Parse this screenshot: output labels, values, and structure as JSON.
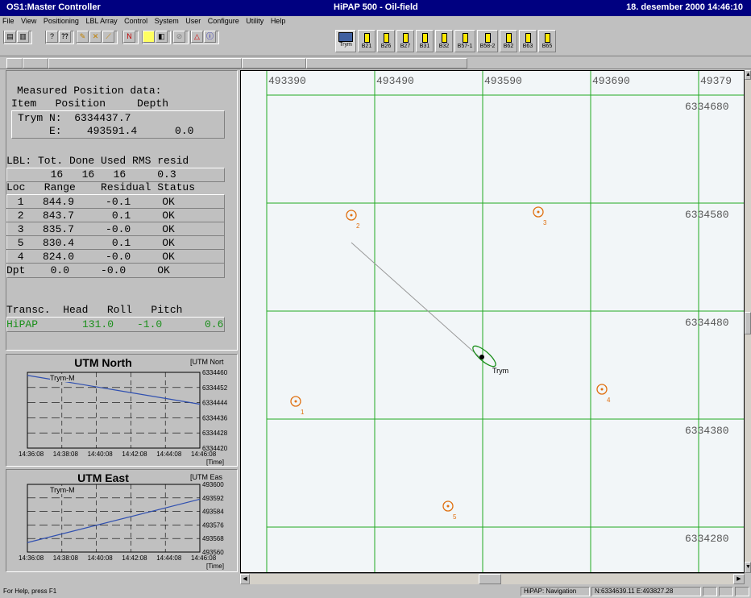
{
  "window": {
    "app_title": "OS1:Master Controller",
    "center_title": "HiPAP 500 - Oil-field",
    "datetime": "18. desember 2000 14:46:10"
  },
  "menu": [
    "File",
    "View",
    "Positioning",
    "LBL Array",
    "Control",
    "System",
    "User",
    "Configure",
    "Utility",
    "Help"
  ],
  "transponders": [
    "Trym",
    "B21",
    "B26",
    "B27",
    "B31",
    "B32",
    "B57-1",
    "B58-2",
    "B62",
    "B63",
    "B65"
  ],
  "measured": {
    "title": "Measured Position data:",
    "hdr": "Item   Position     Depth",
    "row1": "Trym N:  6334437.7",
    "row2": "     E:    493591.4      0.0"
  },
  "lbl": {
    "hdr": "LBL: Tot. Done Used RMS resid",
    "values": "       16   16   16     0.3",
    "col_hdr": "Loc   Range    Residual Status",
    "rows": [
      " 1   844.9     -0.1     OK",
      " 2   843.7      0.1     OK",
      " 3   835.7     -0.0     OK",
      " 5   830.4      0.1     OK",
      " 4   824.0     -0.0     OK"
    ],
    "dpt_row": "Dpt    0.0     -0.0     OK"
  },
  "transc": {
    "hdr": "Transc.  Head   Roll   Pitch",
    "name": "HiPAP",
    "head": "131.0",
    "roll": "-1.0",
    "pitch": "0.6",
    "color": "#1a8f1a"
  },
  "north_chart": {
    "title": "UTM North",
    "unit": "[UTM Nort",
    "legend": "Trym-M",
    "y_ticks": [
      "6334460",
      "6334452",
      "6334444",
      "6334436",
      "6334428",
      "6334420"
    ],
    "x_ticks": [
      "14:36:08",
      "14:38:08",
      "14:40:08",
      "14:42:08",
      "14:44:08",
      "14:46:08"
    ],
    "x_unit": "[Time]"
  },
  "east_chart": {
    "title": "UTM East",
    "unit": "[UTM Eas",
    "legend": "Trym-M",
    "y_ticks": [
      "493600",
      "493592",
      "493584",
      "493576",
      "493568",
      "493560"
    ],
    "x_ticks": [
      "14:36:08",
      "14:38:08",
      "14:40:08",
      "14:42:08",
      "14:44:08",
      "14:46:08"
    ],
    "x_unit": "[Time]"
  },
  "map": {
    "x_labels": [
      "493390",
      "493490",
      "493590",
      "493690",
      "49379"
    ],
    "y_labels": [
      "6334680",
      "6334580",
      "6334480",
      "6334380",
      "6334280"
    ],
    "grid_color": "#22aa22",
    "vessel_label": "Trym",
    "beacon_labels": [
      "1",
      "2",
      "3",
      "4",
      "5"
    ],
    "beacon_color": "#e07010"
  },
  "status": {
    "help": "For Help, press F1",
    "mode": "HiPAP: Navigation",
    "coords": "N:6334639.11 E:493827.28"
  }
}
